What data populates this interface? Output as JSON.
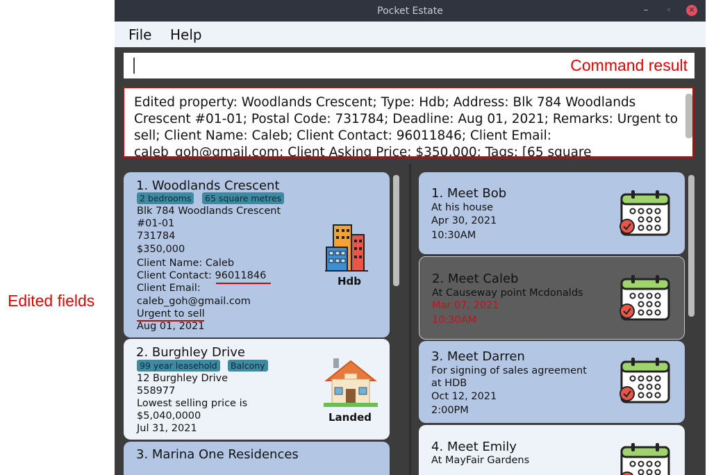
{
  "window": {
    "title": "Pocket Estate"
  },
  "menu": [
    "File",
    "Help"
  ],
  "annotations": {
    "command_result": "Command result",
    "edited_fields": "Edited fields"
  },
  "result_text": "Edited property: Woodlands Crescent; Type: Hdb; Address: Blk 784 Woodlands Crescent #01-01; Postal Code: 731784; Deadline: Aug 01, 2021; Remarks: Urgent to sell; Client Name: Caleb; Client Contact: 96011846; Client Email: caleb_goh@gmail.com; Client Asking Price: $350,000; Tags: [65 square",
  "properties": [
    {
      "title": "1.  Woodlands Crescent",
      "tags": [
        "2 bedrooms",
        "65 square metres"
      ],
      "lines": [
        "Blk 784 Woodlands Crescent",
        "#01-01",
        "731784",
        "$350,000",
        "Client Name: Caleb",
        "Client Contact: 96011846",
        "Client Email:",
        "caleb_goh@gmail.com",
        "Urgent to sell",
        "Aug 01, 2021"
      ],
      "type": "Hdb",
      "icon": "hdb-building-icon"
    },
    {
      "title": "2.  Burghley Drive",
      "tags": [
        "99 year leasehold",
        "Balcony"
      ],
      "lines": [
        "12 Burghley Drive",
        "558977",
        "Lowest selling price is",
        "$5,040,0000",
        "Jul 31, 2021"
      ],
      "type": "Landed",
      "icon": "landed-house-icon"
    },
    {
      "title": "3.  Marina One Residences"
    }
  ],
  "appointments": [
    {
      "title": "1.  Meet Bob",
      "lines": [
        "At his house",
        "Apr 30, 2021",
        "10:30AM"
      ],
      "icon": "calendar-icon"
    },
    {
      "title": "2.  Meet Caleb",
      "lines": [
        "At Causeway point Mcdonalds",
        "Mar 07, 2021",
        "10:30AM"
      ],
      "icon": "calendar-icon"
    },
    {
      "title": "3.  Meet Darren",
      "lines": [
        "For signing of sales agreement",
        "at HDB",
        "Oct 12, 2021",
        "2:00PM"
      ],
      "icon": "calendar-icon"
    },
    {
      "title": "4.  Meet Emily",
      "lines": [
        "At MayFair Gardens"
      ],
      "icon": "calendar-icon"
    }
  ],
  "colors": {
    "accent_red": "#d40000",
    "card_blue": "#b3c6e4",
    "card_white": "#eef3fa",
    "selected_card": "#5d5d5d",
    "overdue_text": "#c0141c"
  }
}
